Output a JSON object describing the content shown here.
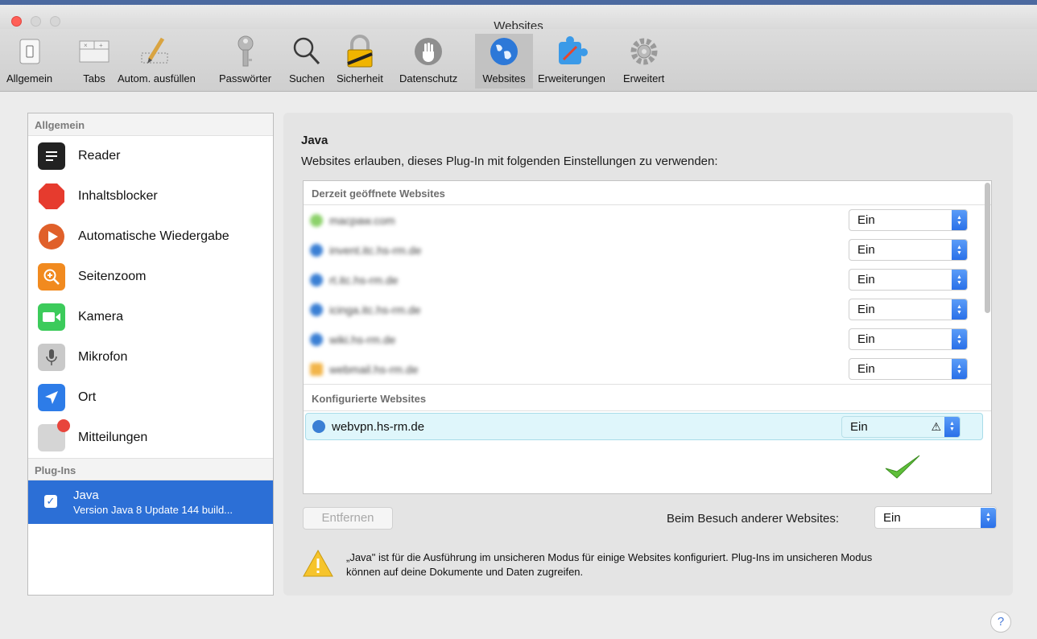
{
  "window": {
    "title": "Websites"
  },
  "toolbar": {
    "items": [
      {
        "label": "Allgemein",
        "icon": "general-switch-icon"
      },
      {
        "label": "Tabs",
        "icon": "tabs-icon"
      },
      {
        "label": "Autom. ausfüllen",
        "icon": "pencil-icon"
      },
      {
        "label": "Passwörter",
        "icon": "key-icon"
      },
      {
        "label": "Suchen",
        "icon": "magnifier-icon"
      },
      {
        "label": "Sicherheit",
        "icon": "padlock-icon"
      },
      {
        "label": "Datenschutz",
        "icon": "hand-icon"
      },
      {
        "label": "Websites",
        "icon": "globe-icon",
        "active": true
      },
      {
        "label": "Erweiterungen",
        "icon": "puzzle-icon"
      },
      {
        "label": "Erweitert",
        "icon": "gear-icon"
      }
    ]
  },
  "sidebar": {
    "general_header": "Allgemein",
    "items": [
      {
        "label": "Reader",
        "icon": "reader-icon"
      },
      {
        "label": "Inhaltsblocker",
        "icon": "stop-icon"
      },
      {
        "label": "Automatische Wiedergabe",
        "icon": "play-icon"
      },
      {
        "label": "Seitenzoom",
        "icon": "zoom-icon"
      },
      {
        "label": "Kamera",
        "icon": "camera-icon"
      },
      {
        "label": "Mikrofon",
        "icon": "microphone-icon"
      },
      {
        "label": "Ort",
        "icon": "location-icon"
      },
      {
        "label": "Mitteilungen",
        "icon": "notification-icon"
      }
    ],
    "plugins_header": "Plug-Ins",
    "plugin": {
      "name": "Java",
      "version": "Version Java 8 Update 144 build...",
      "checked": true
    }
  },
  "main": {
    "title": "Java",
    "description": "Websites erlauben, dieses Plug-In mit folgenden Einstellungen zu verwenden:",
    "open_header": "Derzeit geöffnete Websites",
    "open_sites": [
      {
        "name": "macpaw.com",
        "value": "Ein"
      },
      {
        "name": "invent.itc.hs-rm.de",
        "value": "Ein"
      },
      {
        "name": "rt.itc.hs-rm.de",
        "value": "Ein"
      },
      {
        "name": "icinga.itc.hs-rm.de",
        "value": "Ein"
      },
      {
        "name": "wiki.hs-rm.de",
        "value": "Ein"
      },
      {
        "name": "webmail.hs-rm.de",
        "value": "Ein"
      }
    ],
    "configured_header": "Konfigurierte Websites",
    "configured_sites": [
      {
        "name": "webvpn.hs-rm.de",
        "value": "Ein",
        "warning": "⚠"
      }
    ],
    "remove_button": "Entfernen",
    "other_label": "Beim Besuch anderer Websites:",
    "other_value": "Ein",
    "warning_line1": "„Java\" ist für die Ausführung im unsicheren Modus für einige Websites konfiguriert. Plug-Ins im unsicheren Modus",
    "warning_line2": "können auf deine Dokumente und Daten zugreifen."
  },
  "help_label": "?",
  "colors": {
    "accent": "#2c6fd6",
    "selection": "#dff6fb",
    "popup_arrow": "#2a70e8"
  }
}
